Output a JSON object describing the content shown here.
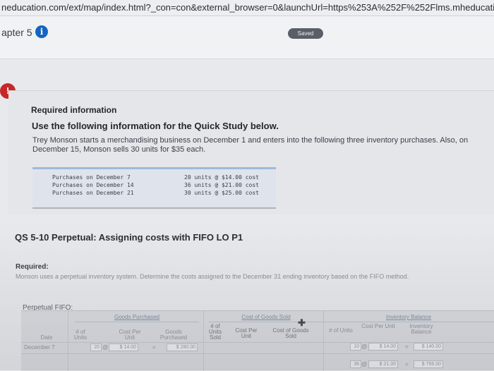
{
  "browser": {
    "url": "neducation.com/ext/map/index.html?_con=con&external_browser=0&launchUrl=https%253A%252F%252Flms.mheducation.com"
  },
  "header": {
    "chapter": "apter 5",
    "info_icon": "i",
    "saved_label": "Saved"
  },
  "alert_icon": "!",
  "required_info": {
    "title": "Required information",
    "subtitle": "Use the following information for the Quick Study below.",
    "body": "Trey Monson starts a merchandising business on December 1 and enters into the following three inventory purchases. Also, on December 15, Monson sells 30 units for $35 each.",
    "purchases": [
      {
        "label": "Purchases on December 7",
        "detail": "20 units @ $14.00 cost"
      },
      {
        "label": "Purchases on December 14",
        "detail": "36 units @ $21.00 cost"
      },
      {
        "label": "Purchases on December 21",
        "detail": "30 units @ $25.00 cost"
      }
    ]
  },
  "question": {
    "title": "QS 5-10 Perpetual: Assigning costs with FIFO LO P1",
    "required_label": "Required:",
    "required_text": "Monson uses a perpetual inventory system. Determine the costs assigned to the December 31 ending inventory based on the FIFO method."
  },
  "table": {
    "label": "Perpetual FIFO:",
    "groups": {
      "goods_purchased": "Goods Purchased",
      "cost_of_goods_sold": "Cost of Goods Sold",
      "inventory_balance": "Inventory Balance"
    },
    "columns": {
      "date": "Date",
      "num_units": "# of Units",
      "cost_per_unit": "Cost Per Unit",
      "goods_purchased": "Goods Purchased",
      "units_sold": "# of Units Sold",
      "cogs_cost_per_unit": "Cost Per Unit",
      "cost_of_goods_sold": "Cost of Goods Sold",
      "inv_num_units": "# of Units",
      "inv_cost_per_unit": "Cost Per Unit",
      "inventory_balance": "Inventory Balance"
    },
    "row1": {
      "date": "December 7",
      "units": "20",
      "at": "@",
      "cost_per_unit": "$ 14.00",
      "equals": "=",
      "goods_purchased": "$ 280.00"
    },
    "balance_rows": [
      {
        "units": "10",
        "at": "@",
        "cost_per_unit": "$ 14.00",
        "equals": "=",
        "balance": "$ 140.00"
      },
      {
        "units": "36",
        "at": "@",
        "cost_per_unit": "$ 21.00",
        "equals": "=",
        "balance": "$ 756.00"
      }
    ]
  },
  "colors": {
    "info_blue": "#1565c0",
    "alert_red": "#c62828",
    "saved_gray": "#5a5e67"
  }
}
